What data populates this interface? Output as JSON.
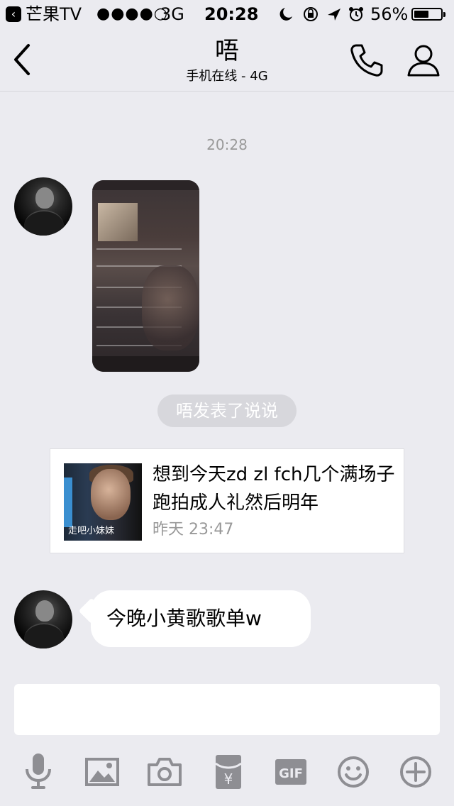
{
  "status_bar": {
    "carrier": "芒果TV",
    "signal_dots": "●●●●○",
    "network": "3G",
    "time": "20:28",
    "battery_text": "56%",
    "battery_level": 0.56,
    "icons": [
      "moon-icon",
      "rotation-lock-icon",
      "location-icon",
      "alarm-icon"
    ]
  },
  "nav": {
    "title": "唔",
    "subtitle": "手机在线 - 4G",
    "icons": [
      "back-icon",
      "phone-icon",
      "profile-icon"
    ]
  },
  "chat": {
    "timestamp": "20:28",
    "system_note": "唔发表了说说",
    "shared_post": {
      "text": "想到今天zd zl fch几个满场子跑拍成人礼然后明年",
      "time": "昨天 23:47",
      "thumb_caption": "走吧小妹妹"
    },
    "text_message": "今晚小黄歌歌单w"
  },
  "input": {
    "value": "",
    "placeholder": ""
  },
  "toolbar": {
    "icons": [
      "microphone-icon",
      "image-icon",
      "camera-icon",
      "red-packet-icon",
      "gif-icon",
      "emoji-icon",
      "plus-icon"
    ],
    "gif_label": "GIF",
    "red_packet_label": "¥"
  },
  "colors": {
    "background": "#ebebf0",
    "icon_gray": "#8e8e93",
    "timestamp_gray": "#999999",
    "bubble_white": "#ffffff",
    "system_note_bg": "#d7d7dc"
  }
}
